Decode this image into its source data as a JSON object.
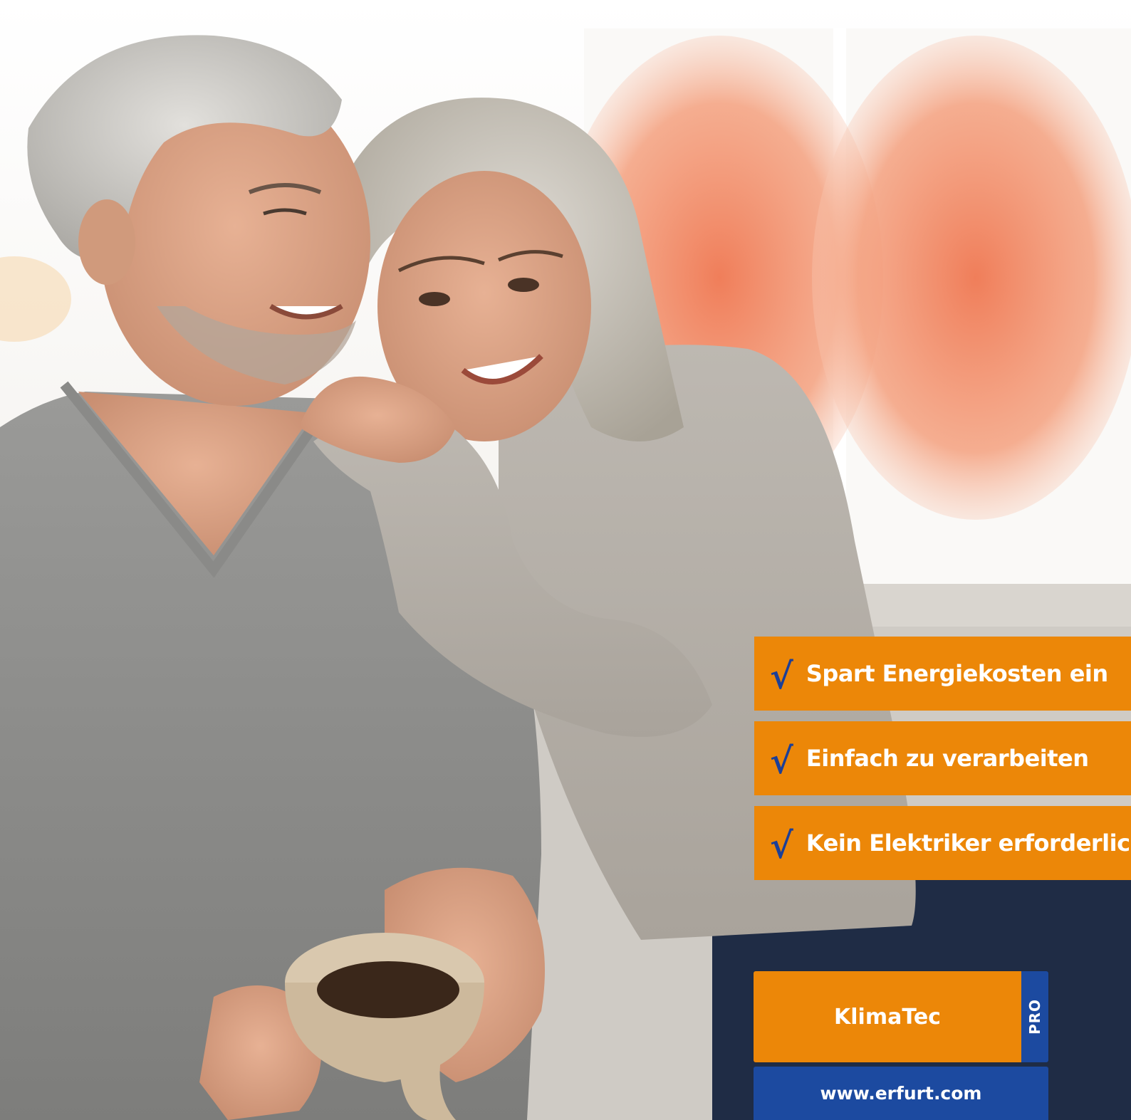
{
  "benefits": [
    {
      "check_icon": "checkmark-icon",
      "label": "Spart Energiekosten ein"
    },
    {
      "check_icon": "checkmark-icon",
      "label": "Einfach zu verarbeiten"
    },
    {
      "check_icon": "checkmark-icon",
      "label": "Kein Elektriker erforderlich"
    }
  ],
  "product": {
    "name": "KlimaTec",
    "tag": "PRO"
  },
  "website": "www.erfurt.com",
  "colors": {
    "orange": "#ec8708",
    "blue": "#1c4aa0",
    "check_blue": "#1c3f97",
    "radiator_glow": "#f08a6a"
  },
  "check_glyph": "√"
}
